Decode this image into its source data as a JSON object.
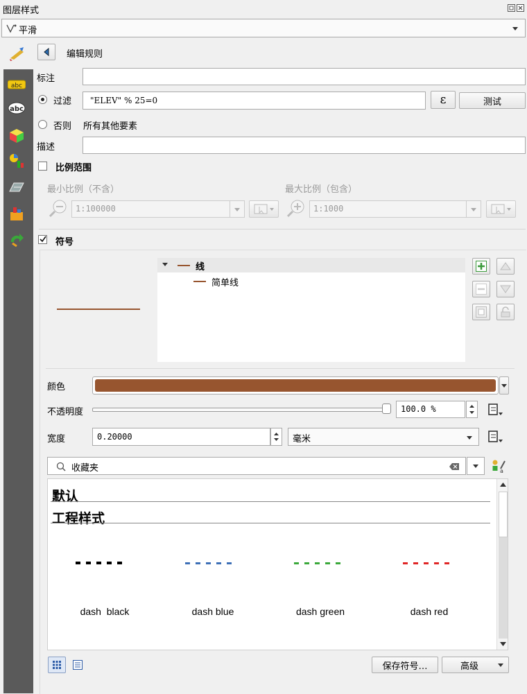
{
  "window": {
    "title": "图层样式"
  },
  "renderer": {
    "icon": "smooth-line-icon",
    "selected": "平滑"
  },
  "rule": {
    "back_label": "编辑规则",
    "label_caption": "标注",
    "label_value": "",
    "filter_caption": "过滤",
    "filter_value": "\"ELEV\" % 25=0",
    "expression_symbol": "ε",
    "test_button": "测试",
    "else_caption": "否则",
    "else_text": "所有其他要素",
    "description_caption": "描述",
    "description_value": ""
  },
  "scale_range": {
    "title": "比例范围",
    "min_label": "最小比例（不含）",
    "min_value": "1:100000",
    "max_label": "最大比例（包含）",
    "max_value": "1:1000"
  },
  "symbol": {
    "title": "符号",
    "tree": [
      {
        "label": "线",
        "level": 0
      },
      {
        "label": "简单线",
        "level": 1
      }
    ],
    "color_label": "颜色",
    "color_value": "#97552f",
    "opacity_label": "不透明度",
    "opacity_value": "100.0 %",
    "opacity_fraction": 1.0,
    "width_label": "宽度",
    "width_value": "0.20000",
    "unit_value": "毫米"
  },
  "library": {
    "search_value": "收藏夹",
    "groups": [
      "默认",
      "工程样式"
    ],
    "items": [
      {
        "name": "dash  black",
        "color": "#000000"
      },
      {
        "name": "dash blue",
        "color": "#3d6fb6"
      },
      {
        "name": "dash green",
        "color": "#3aa83a"
      },
      {
        "name": "dash red",
        "color": "#e02525"
      }
    ]
  },
  "footer": {
    "save_button": "保存符号…",
    "advanced_button": "高级"
  },
  "colors": {
    "sidebar": "#5a5a5a",
    "line_preview": "#97552f"
  }
}
